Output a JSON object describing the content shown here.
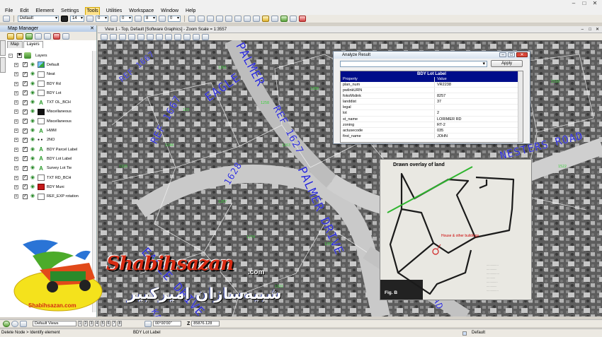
{
  "app": {
    "window_controls": [
      "–",
      "□",
      "✕"
    ]
  },
  "menu": {
    "items": [
      "File",
      "Edit",
      "Element",
      "Settings",
      "Tools",
      "Utilities",
      "Workspace",
      "Window",
      "Help"
    ],
    "active": "Tools"
  },
  "toolbar2": {
    "level_value": "Default",
    "weight_value": "14",
    "style_value": "0",
    "line_value": "0",
    "color_value": "8",
    "priority_value": "0"
  },
  "map_manager": {
    "title": "Map Manager",
    "tabs": [
      "Map",
      "Layers"
    ],
    "active_tab": "Layers",
    "root_label": "Layers",
    "layers": [
      {
        "label": "Default",
        "symbol": "default"
      },
      {
        "label": "Neat",
        "symbol": "blank"
      },
      {
        "label": "BDY Rd",
        "symbol": "blank"
      },
      {
        "label": "BDY Lot",
        "symbol": "blank"
      },
      {
        "label": "TXT OL_BCH",
        "symbol": "text"
      },
      {
        "label": "Miscellaneous",
        "symbol": "black"
      },
      {
        "label": "Miscellaneous",
        "symbol": "blank"
      },
      {
        "label": "HWM",
        "symbol": "text"
      },
      {
        "label": "2NO",
        "symbol": "dots"
      },
      {
        "label": "BDY Parcel Label",
        "symbol": "text"
      },
      {
        "label": "BDY Lot Label",
        "symbol": "text"
      },
      {
        "label": "Survey Lot Tie",
        "symbol": "text"
      },
      {
        "label": "TXT RD_BCH",
        "symbol": "blank"
      },
      {
        "label": "BDY Muni",
        "symbol": "red"
      },
      {
        "label": "REF_EXP rotation",
        "symbol": "blank"
      }
    ]
  },
  "view": {
    "title": "View 1 - Top, Default [Software Graphics] - Zoom Scale = 1:3557"
  },
  "map_labels": {
    "eagle_drive": "EAGLE DRIVE",
    "eagle_top": "EAGLE",
    "palmer_drive": "PALMER DRIVE",
    "palmer_top": "PALMER",
    "nesters_road": "NESTERS ROAD",
    "ref_1667": "REF 1667",
    "ref_1627": "REF 1627",
    "ref_top": "REF 1667",
    "misc_1628": "1628",
    "road_ad": "AD",
    "road_ka": "KA"
  },
  "analyze_result": {
    "title": "Analyze Result",
    "apply_label": "Apply",
    "caption": "BDY Lot Label",
    "col_property": "Property",
    "col_value": "Value",
    "rows": [
      {
        "p": "plan_num",
        "v": "VR2238"
      },
      {
        "p": "pwlinkURN",
        "v": ""
      },
      {
        "p": "fokoMslink",
        "v": "8257"
      },
      {
        "p": "landdist",
        "v": "37"
      },
      {
        "p": "legal",
        "v": ""
      },
      {
        "p": "lot",
        "v": "2"
      },
      {
        "p": "st_name",
        "v": "LORIMER RD"
      },
      {
        "p": "zoning",
        "v": "RT-2"
      },
      {
        "p": "actusecode",
        "v": "035"
      },
      {
        "p": "first_name",
        "v": "JOHN"
      }
    ]
  },
  "overlay": {
    "title": "Drawn overlay of land",
    "house_label": "House & other buildings",
    "fig_label": "Fig. B"
  },
  "watermark": {
    "brand": "Shabihsazan",
    "com": ".com",
    "persian": "شبیه‌سازان امیرکبیر",
    "logo_text": "Shabihsazan.com"
  },
  "statusbar": {
    "views_label": "Default Views",
    "view_numbers": [
      "1",
      "2",
      "3",
      "4",
      "5",
      "6",
      "7",
      "8"
    ],
    "angle_value": "00°00'00\"",
    "z_label": "Z",
    "z_value": "85876.128",
    "left_prompt": "Delete Node > Identify element",
    "center_text": "BDY Lot Label",
    "right_text": "Default"
  },
  "colors": {
    "map_label": "#2b2bd6",
    "watermark_red": "#d52a12",
    "table_header": "#000d8a"
  }
}
